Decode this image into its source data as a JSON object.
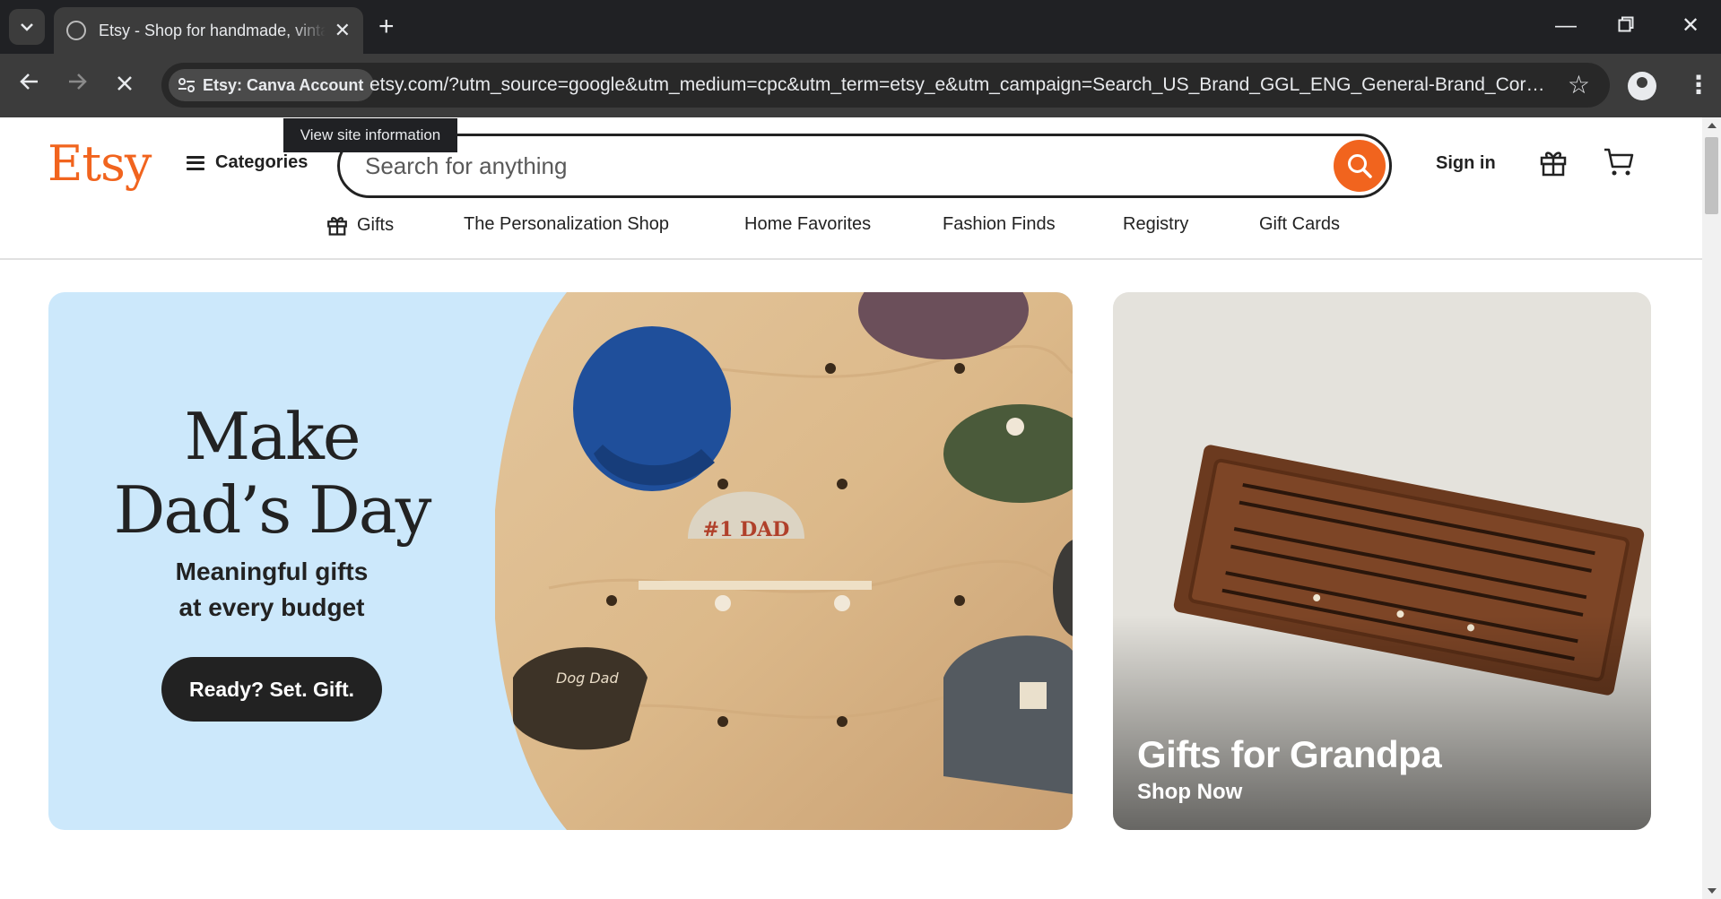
{
  "browser": {
    "tab_title": "Etsy - Shop for handmade, vintage, custom, and unique gifts",
    "site_chip_label": "Etsy: Canva Account",
    "url": "etsy.com/?utm_source=google&utm_medium=cpc&utm_term=etsy_e&utm_campaign=Search_US_Brand_GGL_ENG_General-Brand_Core_All_Exact",
    "tooltip": "View site information",
    "icons": {
      "tab_search": "chevron-down-icon",
      "close_tab": "close-icon",
      "new_tab": "plus-icon",
      "minimize": "minimize-icon",
      "restore": "restore-icon",
      "close_window": "close-icon",
      "back": "back-arrow-icon",
      "forward": "forward-arrow-icon",
      "stop": "stop-icon",
      "bookmark": "star-icon",
      "profile": "profile-icon",
      "menu": "kebab-menu-icon"
    }
  },
  "header": {
    "logo": "Etsy",
    "categories_label": "Categories",
    "search_placeholder": "Search for anything",
    "sign_in_label": "Sign in"
  },
  "subnav": {
    "items": [
      "Gifts",
      "The Personalization Shop",
      "Home Favorites",
      "Fashion Finds",
      "Registry",
      "Gift Cards"
    ]
  },
  "hero": {
    "heading_line1": "Make",
    "heading_line2": "Dad’s Day",
    "sub_line1": "Meaningful gifts",
    "sub_line2": "at every budget",
    "cta_label": "Ready? Set. Gift.",
    "photo_labels": {
      "cap_center": "#1 DAD",
      "cap_left": "Dog Dad"
    }
  },
  "side_banner": {
    "title": "Gifts for Grandpa",
    "link_label": "Shop Now"
  },
  "colors": {
    "brand_orange": "#f1641e",
    "hero_blue": "#cce8fb",
    "text_dark": "#222222",
    "chrome_dark": "#202124",
    "chrome_toolbar": "#3c3c3c"
  }
}
